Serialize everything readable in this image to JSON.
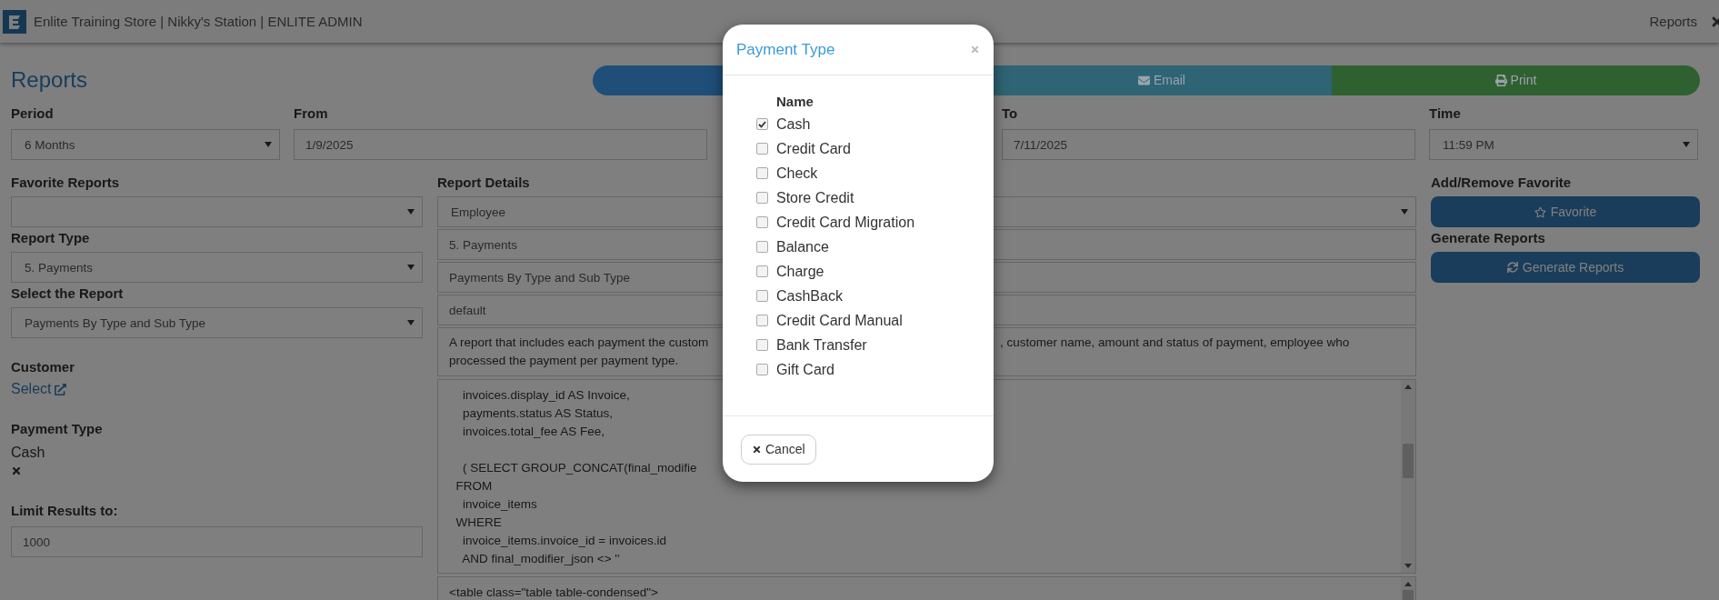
{
  "header": {
    "title": "Enlite Training Store | Nikky's Station | ENLITE ADMIN",
    "nav": "Reports"
  },
  "page_title": "Reports",
  "actions": [
    {
      "kind": "plain",
      "color": "#1f4e79"
    },
    {
      "kind": "email",
      "label": "Email",
      "color": "#2e6474"
    },
    {
      "kind": "print",
      "label": "Print",
      "color": "#2f6130"
    }
  ],
  "period": {
    "label": "Period",
    "value": "6 Months"
  },
  "from": {
    "label": "From",
    "value": "1/9/2025"
  },
  "to": {
    "label": "To",
    "value": "7/11/2025"
  },
  "time": {
    "label": "Time",
    "value": "11:59 PM"
  },
  "favorite_reports": {
    "label": "Favorite Reports"
  },
  "report_type": {
    "label": "Report Type",
    "value": "5. Payments"
  },
  "select_report": {
    "label": "Select the Report",
    "value": "Payments By Type and Sub Type"
  },
  "customer": {
    "label": "Customer",
    "link": "Select"
  },
  "payment_type": {
    "label": "Payment Type",
    "value": "Cash"
  },
  "limit": {
    "label": "Limit Results to:",
    "value": "1000"
  },
  "report_details": {
    "label": "Report Details",
    "fields": [
      {
        "kind": "select",
        "value": "Employee"
      },
      {
        "kind": "text",
        "value": "5. Payments"
      },
      {
        "kind": "text",
        "value": "Payments By Type and Sub Type"
      },
      {
        "kind": "text",
        "value": "default"
      }
    ],
    "description": {
      "left": "A report that includes each payment the custom",
      "right": ", customer name, amount and status of payment, employee who",
      "line_2": "processed the payment per payment type."
    },
    "query": "    invoices.display_id AS Invoice,\n    payments.status AS Status,\n    invoices.total_fee AS Fee,\n\n    ( SELECT GROUP_CONCAT(final_modifie\n  FROM\n    invoice_items\n  WHERE\n    invoice_items.invoice_id = invoices.id\n    AND final_modifier_json <> ''",
    "template": "<table class=\"table table-condensed\">"
  },
  "favorite": {
    "label": "Add/Remove Favorite",
    "button": "Favorite"
  },
  "generate": {
    "label": "Generate Reports",
    "button": "Generate Reports"
  },
  "modal": {
    "title": "Payment Type",
    "column": "Name",
    "items": [
      {
        "label": "Cash",
        "checked": true
      },
      {
        "label": "Credit Card",
        "checked": false
      },
      {
        "label": "Check",
        "checked": false
      },
      {
        "label": "Store Credit",
        "checked": false
      },
      {
        "label": "Credit Card Migration",
        "checked": false
      },
      {
        "label": "Balance",
        "checked": false
      },
      {
        "label": "Charge",
        "checked": false
      },
      {
        "label": "CashBack",
        "checked": false
      },
      {
        "label": "Credit Card Manual",
        "checked": false
      },
      {
        "label": "Bank Transfer",
        "checked": false
      },
      {
        "label": "Gift Card",
        "checked": false
      }
    ],
    "cancel": "Cancel"
  }
}
